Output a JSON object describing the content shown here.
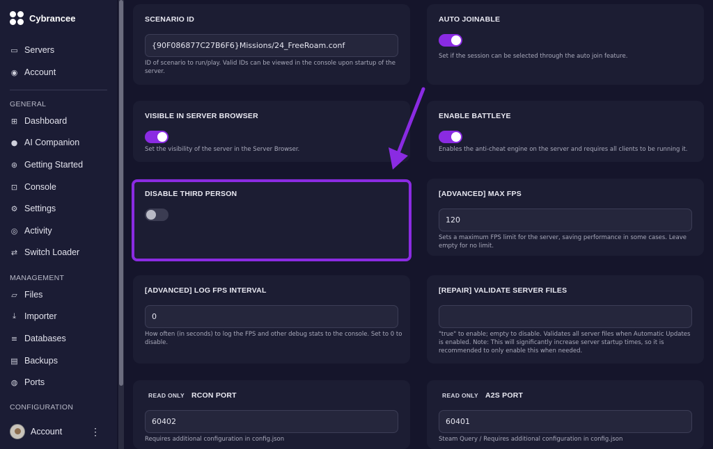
{
  "brand": {
    "name": "Cybrancee"
  },
  "sidebar": {
    "top_items": [
      {
        "label": "Servers",
        "icon": "server-icon"
      },
      {
        "label": "Account",
        "icon": "user-circle-icon"
      }
    ],
    "general_label": "GENERAL",
    "general_items": [
      {
        "label": "Dashboard",
        "icon": "grid-icon"
      },
      {
        "label": "AI Companion",
        "icon": "chat-icon"
      },
      {
        "label": "Getting Started",
        "icon": "lifebuoy-icon"
      },
      {
        "label": "Console",
        "icon": "terminal-icon"
      },
      {
        "label": "Settings",
        "icon": "gear-icon"
      },
      {
        "label": "Activity",
        "icon": "eye-icon"
      },
      {
        "label": "Switch Loader",
        "icon": "swap-icon"
      }
    ],
    "management_label": "MANAGEMENT",
    "management_items": [
      {
        "label": "Files",
        "icon": "folder-icon"
      },
      {
        "label": "Importer",
        "icon": "download-icon"
      },
      {
        "label": "Databases",
        "icon": "database-icon"
      },
      {
        "label": "Backups",
        "icon": "archive-icon"
      },
      {
        "label": "Ports",
        "icon": "globe-icon"
      }
    ],
    "configuration_label": "CONFIGURATION",
    "account_label": "Account"
  },
  "cards": {
    "scenario_id": {
      "title": "SCENARIO ID",
      "value": "{90F086877C27B6F6}Missions/24_FreeRoam.conf",
      "help": "ID of scenario to run/play. Valid IDs can be viewed in the console upon startup of the server."
    },
    "auto_joinable": {
      "title": "AUTO JOINABLE",
      "enabled": true,
      "help": "Set if the session can be selected through the auto join feature."
    },
    "visible_browser": {
      "title": "VISIBLE IN SERVER BROWSER",
      "enabled": true,
      "help": "Set the visibility of the server in the Server Browser."
    },
    "battleye": {
      "title": "ENABLE BATTLEYE",
      "enabled": true,
      "help": "Enables the anti-cheat engine on the server and requires all clients to be running it."
    },
    "third_person": {
      "title": "DISABLE THIRD PERSON",
      "enabled": false
    },
    "max_fps": {
      "title": "[ADVANCED] MAX FPS",
      "value": "120",
      "help": "Sets a maximum FPS limit for the server, saving performance in some cases. Leave empty for no limit."
    },
    "log_fps": {
      "title": "[ADVANCED] LOG FPS INTERVAL",
      "value": "0",
      "help": "How often (in seconds) to log the FPS and other debug stats to the console. Set to 0 to disable."
    },
    "validate": {
      "title": "[REPAIR] VALIDATE SERVER FILES",
      "value": "",
      "help": "\"true\" to enable; empty to disable. Validates all server files when Automatic Updates is enabled. Note: This will significantly increase server startup times, so it is recommended to only enable this when needed."
    },
    "rcon_port": {
      "badge": "READ ONLY",
      "title": "RCON PORT",
      "value": "60402",
      "help": "Requires additional configuration in config.json"
    },
    "a2s_port": {
      "badge": "READ ONLY",
      "title": "A2S PORT",
      "value": "60401",
      "help": "Steam Query / Requires additional configuration in config.json"
    }
  },
  "colors": {
    "accent": "#8a2be2",
    "background": "#15152b",
    "card": "#1c1d33"
  }
}
